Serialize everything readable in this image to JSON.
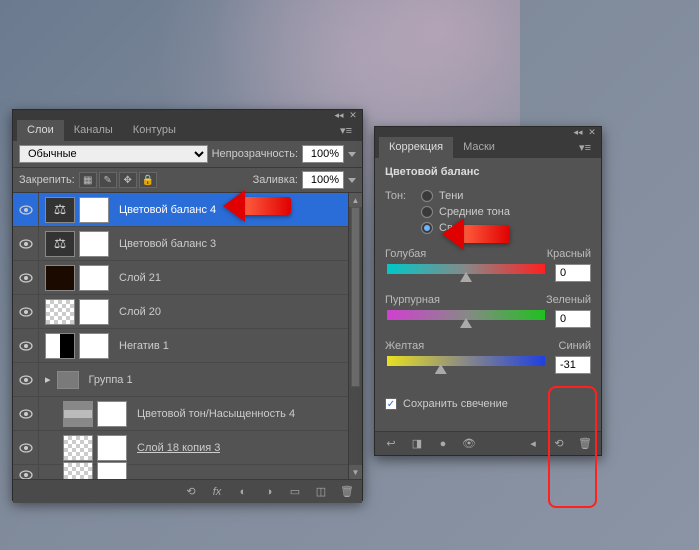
{
  "layers_panel": {
    "tabs": [
      "Слои",
      "Каналы",
      "Контуры"
    ],
    "active_tab": 0,
    "blend_mode": "Обычные",
    "opacity_label": "Непрозрачность:",
    "opacity_value": "100%",
    "lock_label": "Закрепить:",
    "fill_label": "Заливка:",
    "fill_value": "100%",
    "layers": [
      {
        "name": "Цветовой баланс 4",
        "type": "adjust-balance",
        "selected": true
      },
      {
        "name": "Цветовой баланс 3",
        "type": "adjust-balance"
      },
      {
        "name": "Слой 21",
        "type": "pixel",
        "thumb_color": "#1a0a00"
      },
      {
        "name": "Слой 20",
        "type": "pixel",
        "thumb_checker": true
      },
      {
        "name": "Негатив 1",
        "type": "adjust-invert"
      },
      {
        "name": "Группа 1",
        "type": "group"
      },
      {
        "name": "Цветовой тон/Насыщенность 4",
        "type": "adjust-hue",
        "indent": true
      },
      {
        "name": "Слой 18 копия 3",
        "type": "pixel",
        "indent": true,
        "underline": true,
        "thumb_checker": true
      },
      {
        "name": "",
        "type": "pixel",
        "indent": true,
        "thumb_checker": true,
        "partial": true
      }
    ]
  },
  "corr_panel": {
    "tabs": [
      "Коррекция",
      "Маски"
    ],
    "active_tab": 0,
    "title": "Цветовой баланс",
    "tone_label": "Тон:",
    "tone_options": [
      "Тени",
      "Средние тона",
      "Света"
    ],
    "tone_selected": 2,
    "sliders": [
      {
        "left": "Голубая",
        "right": "Красный",
        "value": "0",
        "pos": 50
      },
      {
        "left": "Пурпурная",
        "right": "Зеленый",
        "value": "0",
        "pos": 50
      },
      {
        "left": "Желтая",
        "right": "Синий",
        "value": "-31",
        "pos": 34
      }
    ],
    "preserve_label": "Сохранить свечение",
    "preserve_checked": true
  }
}
